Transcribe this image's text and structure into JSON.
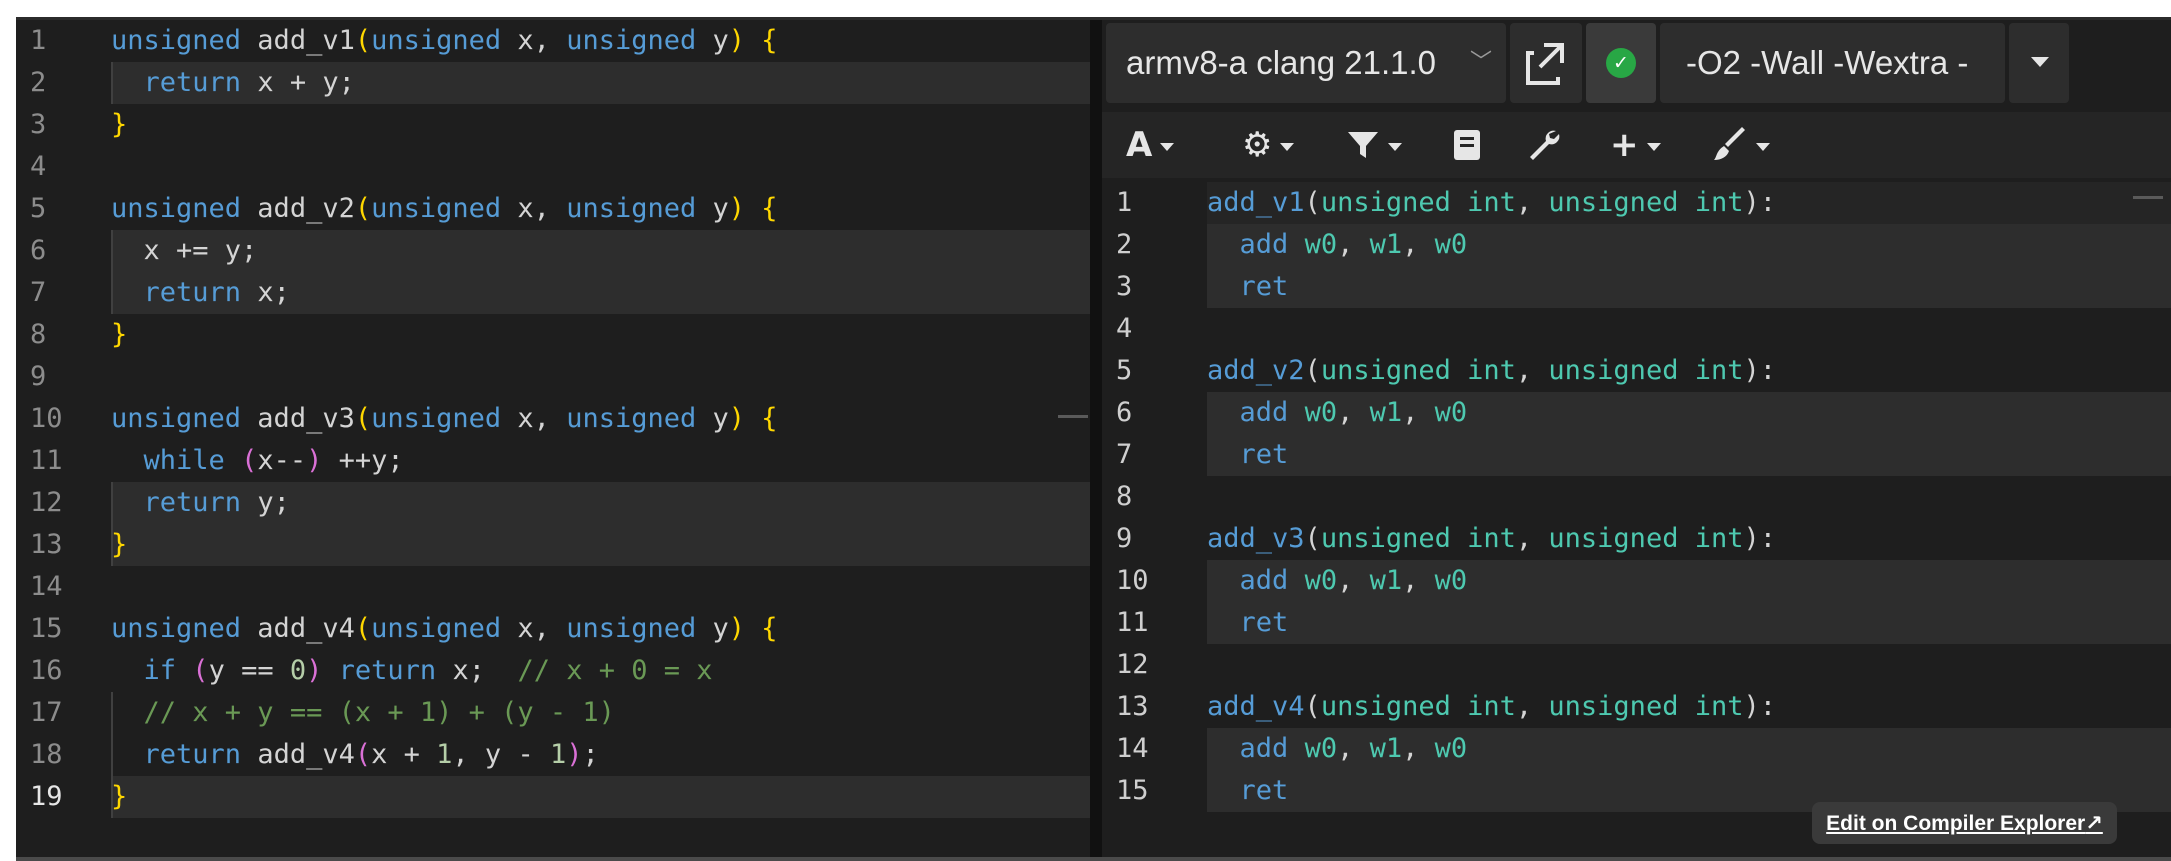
{
  "editor": {
    "line_numbers": [
      "1",
      "2",
      "3",
      "4",
      "5",
      "6",
      "7",
      "8",
      "9",
      "10",
      "11",
      "12",
      "13",
      "14",
      "15",
      "16",
      "17",
      "18",
      "19"
    ],
    "current_line": 19,
    "lines": [
      [
        [
          "kw",
          "unsigned"
        ],
        [
          "t",
          " add_v1"
        ],
        [
          "br1",
          "("
        ],
        [
          "kw",
          "unsigned"
        ],
        [
          "t",
          " x, "
        ],
        [
          "kw",
          "unsigned"
        ],
        [
          "t",
          " y"
        ],
        [
          "br1",
          ")"
        ],
        [
          "t",
          " "
        ],
        [
          "br1",
          "{"
        ]
      ],
      [
        [
          "t",
          "  "
        ],
        [
          "kw",
          "return"
        ],
        [
          "t",
          " x + y;"
        ]
      ],
      [
        [
          "br1",
          "}"
        ]
      ],
      [],
      [
        [
          "kw",
          "unsigned"
        ],
        [
          "t",
          " add_v2"
        ],
        [
          "br1",
          "("
        ],
        [
          "kw",
          "unsigned"
        ],
        [
          "t",
          " x, "
        ],
        [
          "kw",
          "unsigned"
        ],
        [
          "t",
          " y"
        ],
        [
          "br1",
          ")"
        ],
        [
          "t",
          " "
        ],
        [
          "br1",
          "{"
        ]
      ],
      [
        [
          "t",
          "  x += y;"
        ]
      ],
      [
        [
          "t",
          "  "
        ],
        [
          "kw",
          "return"
        ],
        [
          "t",
          " x;"
        ]
      ],
      [
        [
          "br1",
          "}"
        ]
      ],
      [],
      [
        [
          "kw",
          "unsigned"
        ],
        [
          "t",
          " add_v3"
        ],
        [
          "br1",
          "("
        ],
        [
          "kw",
          "unsigned"
        ],
        [
          "t",
          " x, "
        ],
        [
          "kw",
          "unsigned"
        ],
        [
          "t",
          " y"
        ],
        [
          "br1",
          ")"
        ],
        [
          "t",
          " "
        ],
        [
          "br1",
          "{"
        ]
      ],
      [
        [
          "t",
          "  "
        ],
        [
          "kw",
          "while"
        ],
        [
          "t",
          " "
        ],
        [
          "br2",
          "("
        ],
        [
          "t",
          "x--"
        ],
        [
          "br2",
          ")"
        ],
        [
          "t",
          " ++y;"
        ]
      ],
      [
        [
          "t",
          "  "
        ],
        [
          "kw",
          "return"
        ],
        [
          "t",
          " y;"
        ]
      ],
      [
        [
          "br1",
          "}"
        ]
      ],
      [],
      [
        [
          "kw",
          "unsigned"
        ],
        [
          "t",
          " add_v4"
        ],
        [
          "br1",
          "("
        ],
        [
          "kw",
          "unsigned"
        ],
        [
          "t",
          " x, "
        ],
        [
          "kw",
          "unsigned"
        ],
        [
          "t",
          " y"
        ],
        [
          "br1",
          ")"
        ],
        [
          "t",
          " "
        ],
        [
          "br1",
          "{"
        ]
      ],
      [
        [
          "t",
          "  "
        ],
        [
          "kw",
          "if"
        ],
        [
          "t",
          " "
        ],
        [
          "br2",
          "("
        ],
        [
          "t",
          "y == "
        ],
        [
          "num",
          "0"
        ],
        [
          "br2",
          ")"
        ],
        [
          "t",
          " "
        ],
        [
          "kw",
          "return"
        ],
        [
          "t",
          " x;  "
        ],
        [
          "cm",
          "// x + 0 = x"
        ]
      ],
      [
        [
          "t",
          "  "
        ],
        [
          "cm",
          "// x + y == (x + 1) + (y - 1)"
        ]
      ],
      [
        [
          "t",
          "  "
        ],
        [
          "kw",
          "return"
        ],
        [
          "t",
          " add_v4"
        ],
        [
          "br2",
          "("
        ],
        [
          "t",
          "x + "
        ],
        [
          "num",
          "1"
        ],
        [
          "t",
          ", y - "
        ],
        [
          "num",
          "1"
        ],
        [
          "br2",
          ")"
        ],
        [
          "t",
          ";"
        ]
      ],
      [
        [
          "br1",
          "}"
        ]
      ]
    ]
  },
  "compiler": {
    "name": "armv8-a clang 21.1.0",
    "chevron_icon": "chevron-down-icon",
    "options": "-O2 -Wall -Wextra -",
    "status_color": "#28a745"
  },
  "toolbar": {
    "icons": [
      "font-size-icon",
      "gear-icon",
      "filter-icon",
      "book-icon",
      "wrench-icon",
      "plus-icon",
      "brush-icon"
    ],
    "glyphs": {
      "font": "A",
      "gear": "⚙",
      "filter": "⏷",
      "book": "▤",
      "wrench": "🔧",
      "plus": "+",
      "brush": "🖌"
    }
  },
  "asm": {
    "line_numbers": [
      "1",
      "2",
      "3",
      "4",
      "5",
      "6",
      "7",
      "8",
      "9",
      "10",
      "11",
      "12",
      "13",
      "14",
      "15"
    ],
    "lines": [
      [
        [
          "albl",
          "add_v1"
        ],
        [
          "t",
          "("
        ],
        [
          "aty",
          "unsigned int"
        ],
        [
          "t",
          ", "
        ],
        [
          "aty",
          "unsigned int"
        ],
        [
          "t",
          "):"
        ]
      ],
      [
        [
          "t",
          "  "
        ],
        [
          "aop",
          "add"
        ],
        [
          "t",
          " "
        ],
        [
          "areg",
          "w0"
        ],
        [
          "t",
          ", "
        ],
        [
          "areg",
          "w1"
        ],
        [
          "t",
          ", "
        ],
        [
          "areg",
          "w0"
        ]
      ],
      [
        [
          "t",
          "  "
        ],
        [
          "aop",
          "ret"
        ]
      ],
      [],
      [
        [
          "albl",
          "add_v2"
        ],
        [
          "t",
          "("
        ],
        [
          "aty",
          "unsigned int"
        ],
        [
          "t",
          ", "
        ],
        [
          "aty",
          "unsigned int"
        ],
        [
          "t",
          "):"
        ]
      ],
      [
        [
          "t",
          "  "
        ],
        [
          "aop",
          "add"
        ],
        [
          "t",
          " "
        ],
        [
          "areg",
          "w0"
        ],
        [
          "t",
          ", "
        ],
        [
          "areg",
          "w1"
        ],
        [
          "t",
          ", "
        ],
        [
          "areg",
          "w0"
        ]
      ],
      [
        [
          "t",
          "  "
        ],
        [
          "aop",
          "ret"
        ]
      ],
      [],
      [
        [
          "albl",
          "add_v3"
        ],
        [
          "t",
          "("
        ],
        [
          "aty",
          "unsigned int"
        ],
        [
          "t",
          ", "
        ],
        [
          "aty",
          "unsigned int"
        ],
        [
          "t",
          "):"
        ]
      ],
      [
        [
          "t",
          "  "
        ],
        [
          "aop",
          "add"
        ],
        [
          "t",
          " "
        ],
        [
          "areg",
          "w0"
        ],
        [
          "t",
          ", "
        ],
        [
          "areg",
          "w1"
        ],
        [
          "t",
          ", "
        ],
        [
          "areg",
          "w0"
        ]
      ],
      [
        [
          "t",
          "  "
        ],
        [
          "aop",
          "ret"
        ]
      ],
      [],
      [
        [
          "albl",
          "add_v4"
        ],
        [
          "t",
          "("
        ],
        [
          "aty",
          "unsigned int"
        ],
        [
          "t",
          ", "
        ],
        [
          "aty",
          "unsigned int"
        ],
        [
          "t",
          "):"
        ]
      ],
      [
        [
          "t",
          "  "
        ],
        [
          "aop",
          "add"
        ],
        [
          "t",
          " "
        ],
        [
          "areg",
          "w0"
        ],
        [
          "t",
          ", "
        ],
        [
          "areg",
          "w1"
        ],
        [
          "t",
          ", "
        ],
        [
          "areg",
          "w0"
        ]
      ],
      [
        [
          "t",
          "  "
        ],
        [
          "aop",
          "ret"
        ]
      ]
    ]
  },
  "edit_link": {
    "label": "Edit on Compiler Explorer",
    "icon": "external-link-icon",
    "glyph": "↗"
  }
}
